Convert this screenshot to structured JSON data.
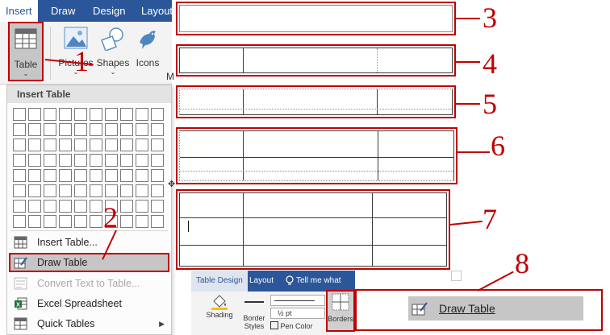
{
  "ribbon": {
    "tabs": [
      "Insert",
      "Draw",
      "Design",
      "Layout"
    ],
    "buttons": {
      "table": "Table",
      "pictures": "Pictures",
      "shapes": "Shapes",
      "icons": "Icons",
      "more_cut": "M"
    }
  },
  "insert_table_menu": {
    "header": "Insert Table",
    "grid": {
      "columns": 10,
      "rows": 8
    },
    "items": [
      {
        "label": "Insert Table...",
        "icon": "table-icon",
        "enabled": true
      },
      {
        "label": "Draw Table",
        "icon": "draw-table-icon",
        "enabled": true,
        "highlighted": true
      },
      {
        "label": "Convert Text to Table...",
        "icon": "convert-icon",
        "enabled": false
      },
      {
        "label": "Excel Spreadsheet",
        "icon": "excel-icon",
        "enabled": true
      },
      {
        "label": "Quick Tables",
        "icon": "quick-tables-icon",
        "enabled": true,
        "submenu": true
      }
    ]
  },
  "table_design": {
    "tabs": [
      "Table Design",
      "Layout",
      "Tell me what you"
    ],
    "shading": "Shading",
    "border_styles_1": "Border",
    "border_styles_2": "Styles",
    "pen_weight": "½ pt",
    "pen_color": "Pen Color",
    "borders": "Borders"
  },
  "draw_table_button": {
    "label": "Draw Table",
    "icon": "draw-table-icon"
  },
  "step_numbers": [
    "1",
    "2",
    "3",
    "4",
    "5",
    "6",
    "7",
    "8"
  ],
  "colors": {
    "accent_red": "#c00000",
    "ribbon_blue": "#2b579a",
    "highlight_gray": "#c6c6c6"
  }
}
